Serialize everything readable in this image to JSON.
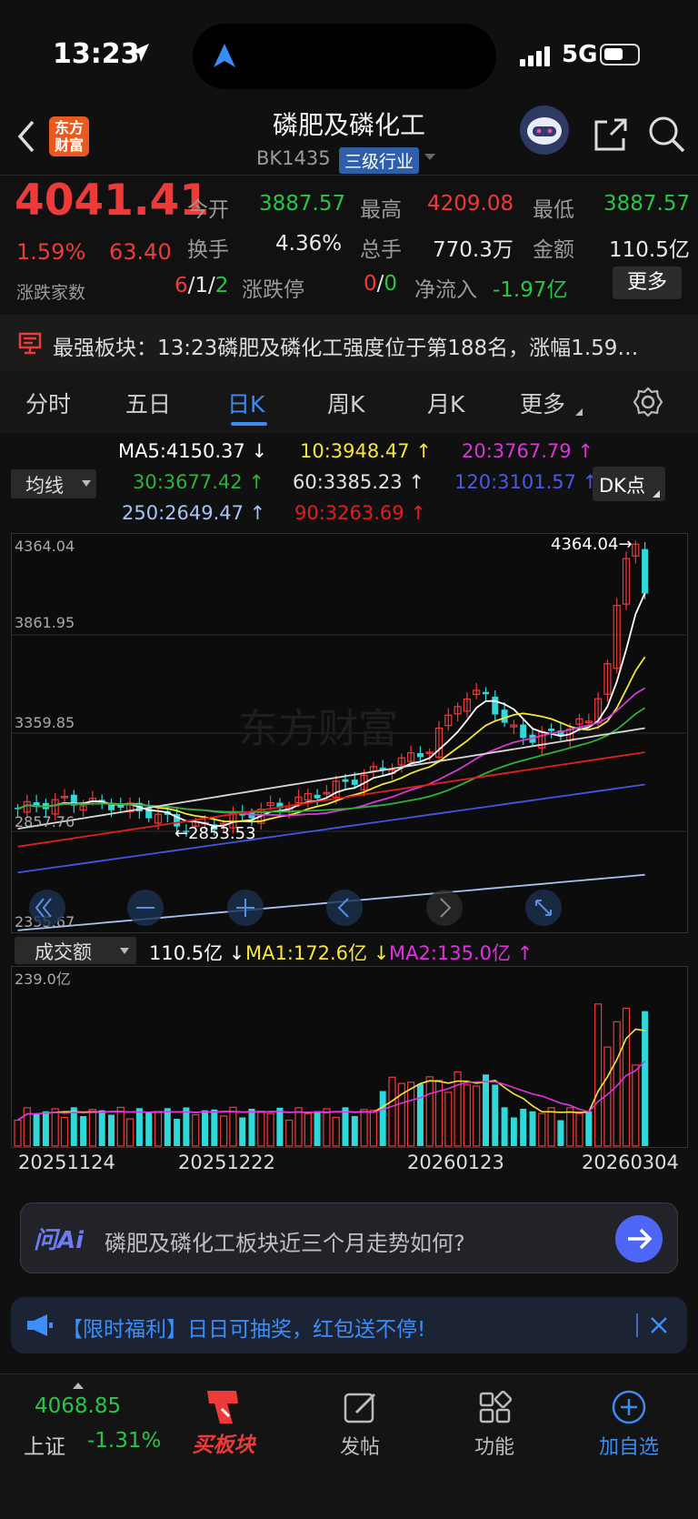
{
  "status": {
    "time": "13:23",
    "network": "5G"
  },
  "header": {
    "title": "磷肥及磷化工",
    "code": "BK1435",
    "tag": "三级行业",
    "logo": "东方财富"
  },
  "quote": {
    "price": "4041.41",
    "pct": "1.59%",
    "change": "63.40",
    "breadth_label": "涨跌家数",
    "breadth_up": "6",
    "breadth_flat": "1",
    "breadth_down": "2",
    "open_label": "今开",
    "open": "3887.57",
    "high_label": "最高",
    "high": "4209.08",
    "low_label": "最低",
    "low": "3887.57",
    "turnover_label": "换手",
    "turnover": "4.36%",
    "vol_label": "总手",
    "vol": "770.3万",
    "amount_label": "金额",
    "amount": "110.5亿",
    "limit_label": "涨跌停",
    "limit_up": "0",
    "limit_down": "0",
    "flow_label": "净流入",
    "flow": "-1.97亿",
    "more": "更多"
  },
  "news": {
    "text": "最强板块：13:23磷肥及磷化工强度位于第188名，涨幅1.59…"
  },
  "tabs": [
    "分时",
    "五日",
    "日K",
    "周K",
    "月K",
    "更多"
  ],
  "ma": {
    "selector": "均线",
    "ma5": "MA5:4150.37",
    "ma10": "10:3948.47",
    "ma20": "20:3767.79",
    "ma30": "30:3677.42",
    "ma60": "60:3385.23",
    "ma120": "120:3101.57",
    "ma250": "250:2649.47",
    "ma90": "90:3263.69",
    "dk": "DK点"
  },
  "colors": {
    "ma5": "#ffffff",
    "ma10": "#f5e640",
    "ma20": "#d43ad4",
    "ma30": "#2bb33a",
    "ma60": "#d8d8d8",
    "ma120": "#4455e0",
    "ma250": "#a8c4f4",
    "ma90": "#e02020",
    "up": "#ef3a3a",
    "down": "#2fd9d9"
  },
  "chart_data": {
    "type": "candlestick",
    "y_ticks": [
      "4364.04",
      "3861.95",
      "3359.85",
      "2857.76",
      "2355.67"
    ],
    "ylim": [
      2355.67,
      4364.04
    ],
    "high_marker": "4364.04",
    "low_marker": "2853.53",
    "dates": [
      "20251124",
      "20251222",
      "20260123",
      "20260304"
    ],
    "volume": {
      "selector": "成交额",
      "value": "110.5亿",
      "ma1": "MA1:172.6亿",
      "ma2": "MA2:135.0亿",
      "ymax_label": "239.0亿",
      "ymax": 239.0
    }
  },
  "ai": {
    "brand": "问Ai",
    "text": "磷肥及磷化工板块近三个月走势如何?"
  },
  "promo": {
    "text": "【限时福利】日日可抽奖，红包送不停!"
  },
  "bottom": {
    "index_value": "4068.85",
    "index_name": "上证",
    "index_pct": "-1.31%",
    "buy": "买板块",
    "post": "发帖",
    "func": "功能",
    "add": "加自选"
  }
}
